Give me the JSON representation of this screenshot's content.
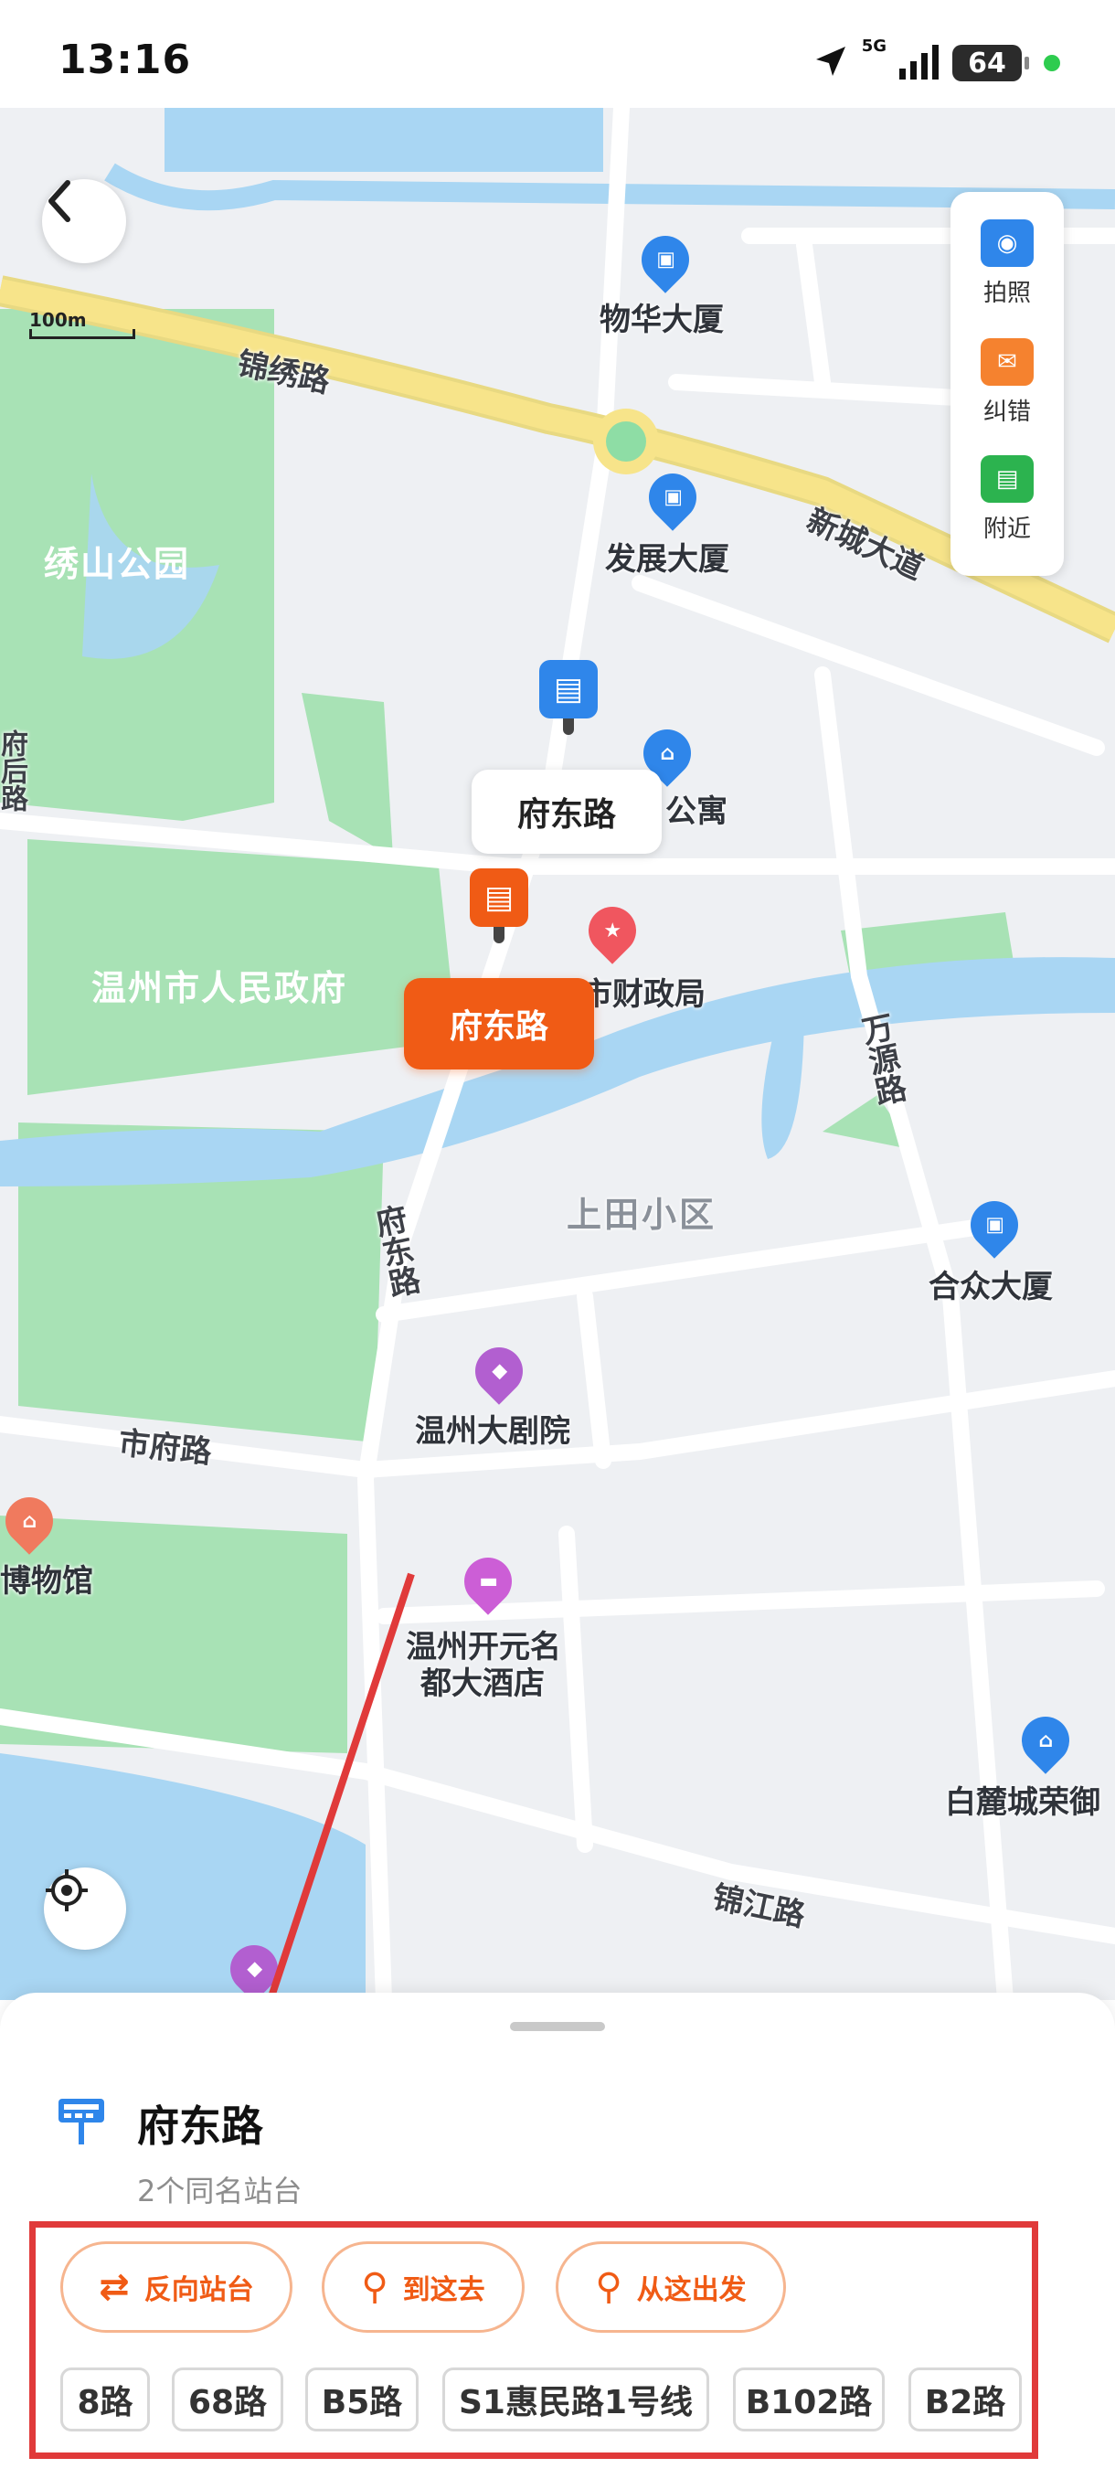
{
  "status_bar": {
    "time": "13:16",
    "network": "5G",
    "battery": "64"
  },
  "map": {
    "scale_label": "100m",
    "roads": {
      "jinxiu": "锦绣路",
      "xincheng": "新城大道",
      "fudong_vertical": "府东路",
      "wanyuan": "万源路",
      "shifu": "市府路",
      "jinjiang": "锦江路",
      "left_edge": "府后路"
    },
    "areas": {
      "xiushan_park": "绣山公园",
      "gov": "温州市人民政府",
      "shangtian": "上田小区"
    },
    "pois": {
      "wuhua": "物华大厦",
      "fazhan": "发展大厦",
      "apartment": "公寓",
      "finance": "市财政局",
      "hezhong": "合众大厦",
      "theatre": "温州大剧院",
      "museum": "博物馆",
      "hotel_line1": "温州开元名",
      "hotel_line2": "都大酒店",
      "bailu": "白麓城荣御"
    },
    "callout_white": "府东路",
    "callout_orange": "府东路"
  },
  "toolbar": {
    "items": [
      {
        "label": "拍照",
        "icon": "camera-icon"
      },
      {
        "label": "纠错",
        "icon": "report-icon"
      },
      {
        "label": "附近",
        "icon": "nearby-bus-icon"
      }
    ]
  },
  "sheet": {
    "title": "府东路",
    "subtitle": "2个同名站台",
    "actions": {
      "reverse": "反向站台",
      "go_here": "到这去",
      "start_here": "从这出发"
    },
    "routes": [
      "8路",
      "68路",
      "B5路",
      "S1惠民路1号线",
      "B102路",
      "B2路"
    ]
  },
  "colors": {
    "accent_orange": "#f05b15",
    "bus_blue": "#2f86ea",
    "highlight_red": "#e03a3a",
    "park_green": "#a8e2b5",
    "water_blue": "#a9d6f3",
    "main_road_yellow": "#f7e48a"
  }
}
